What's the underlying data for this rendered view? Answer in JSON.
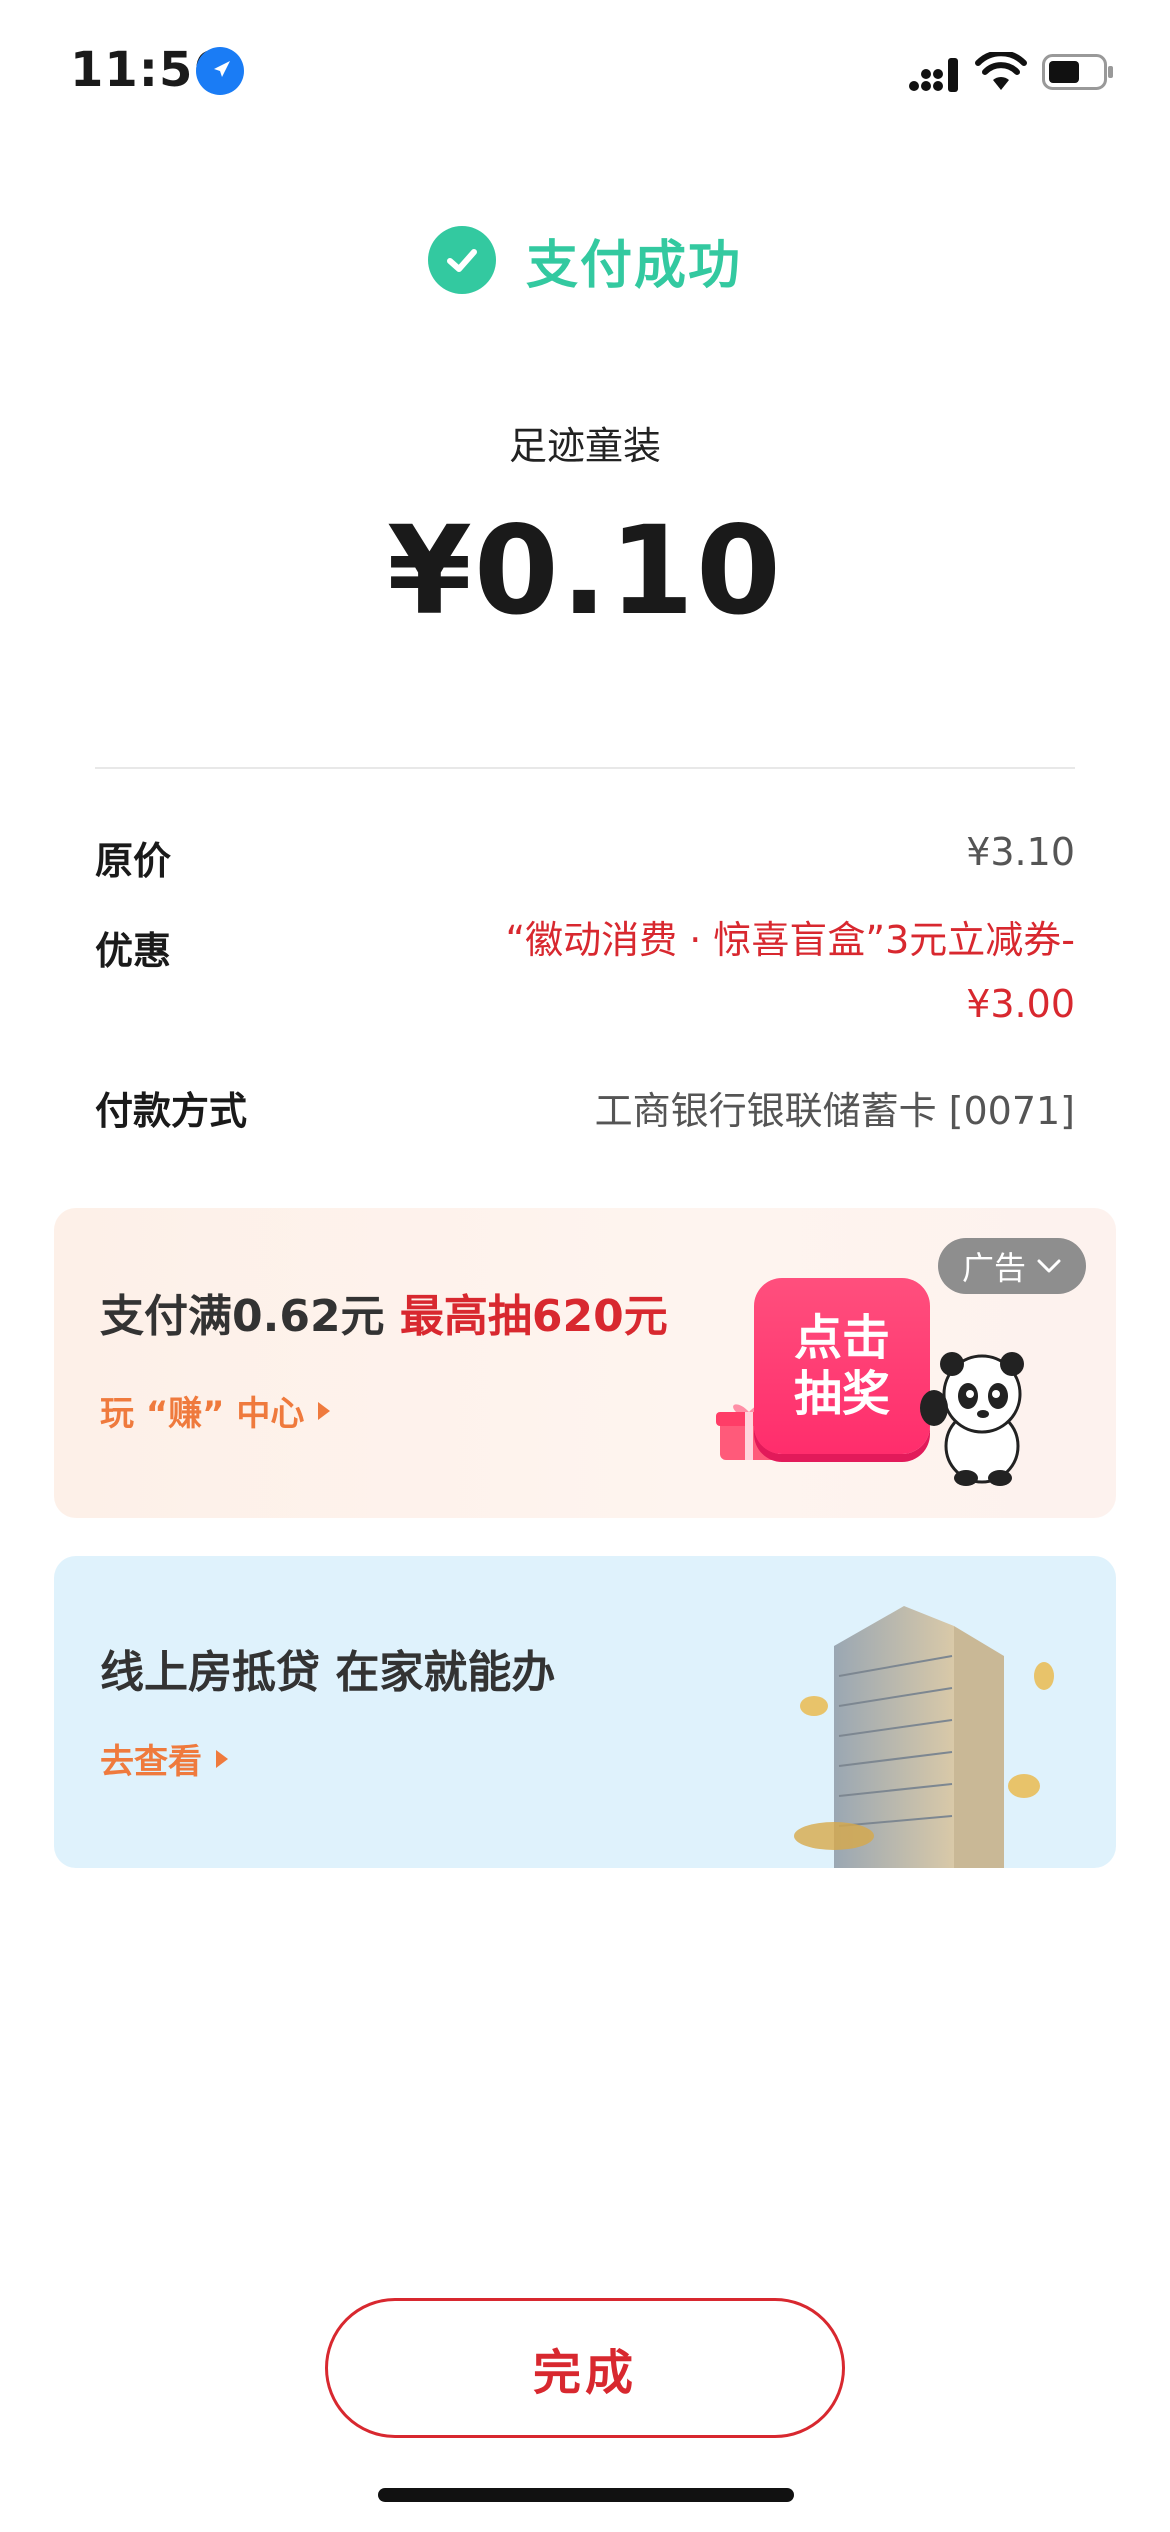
{
  "status_bar": {
    "time": "11:56"
  },
  "header": {
    "success_text": "支付成功"
  },
  "payment": {
    "merchant": "足迹童装",
    "amount": "¥0.10"
  },
  "details": [
    {
      "label": "原价",
      "value": "¥3.10"
    },
    {
      "label": "优惠",
      "value": "“徽动消费 · 惊喜盲盒”3元立减券-¥3.00"
    },
    {
      "label": "付款方式",
      "value": "工商银行银联储蓄卡 [0071]"
    }
  ],
  "promo_lottery": {
    "title_prefix": "支付满0.62元 ",
    "title_highlight": "最高抽620元",
    "link": "玩 “赚” 中心",
    "ad_badge": "广告",
    "button_text": "点击抽奖"
  },
  "promo_mortgage": {
    "title": "线上房抵贷 在家就能办",
    "link": "去查看"
  },
  "footer": {
    "done_label": "完成"
  },
  "colors": {
    "success_green": "#33c9a0",
    "accent_red": "#d8282f",
    "link_orange": "#ef7a3d"
  },
  "icons": [
    "location-arrow-icon",
    "cellular-signal-icon",
    "wifi-icon",
    "battery-icon",
    "checkmark-icon",
    "chevron-down-icon",
    "triangle-right-icon",
    "gift-icon",
    "panda-mascot-icon"
  ]
}
